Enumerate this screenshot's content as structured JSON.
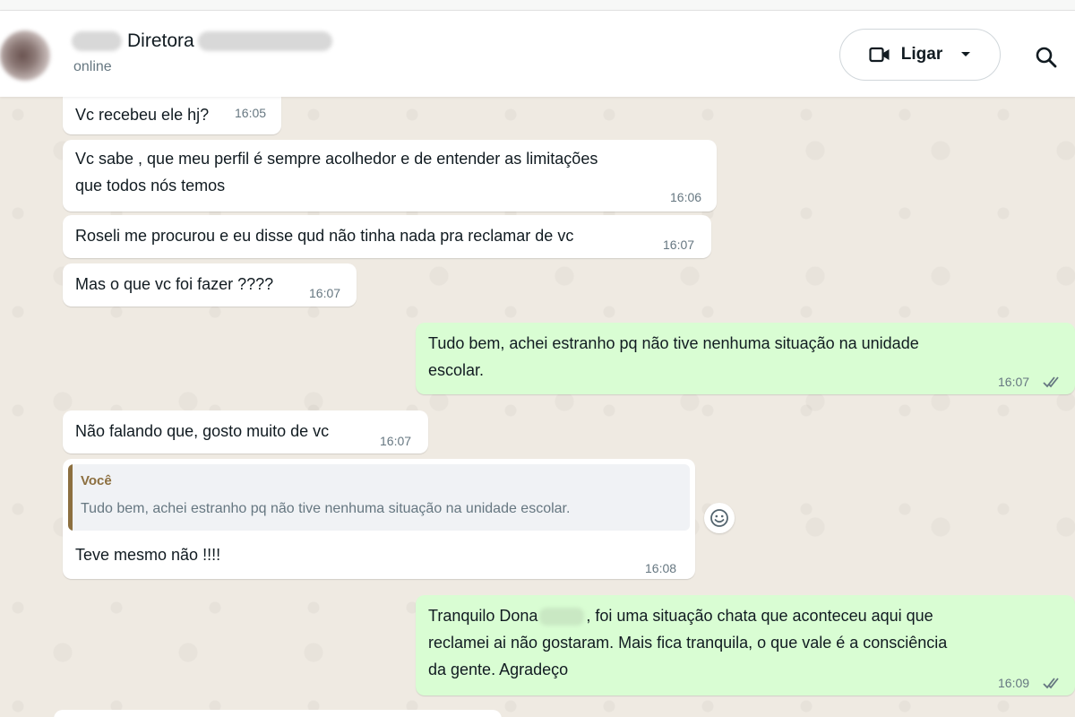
{
  "header": {
    "contact_name": "Diretora",
    "status": "online",
    "call_label": "Ligar"
  },
  "messages": [
    {
      "dir": "in",
      "text": "Vc recebeu ele hj?",
      "time": "16:05"
    },
    {
      "dir": "in",
      "text_lines": [
        "Vc sabe , que meu perfil é sempre acolhedor e de entender as limitações",
        "que todos nós temos"
      ],
      "time": "16:06"
    },
    {
      "dir": "in",
      "text": "Roseli me procurou e eu disse qud não tinha nada pra reclamar de vc",
      "time": "16:07"
    },
    {
      "dir": "in",
      "text": "Mas o que vc foi fazer ????",
      "time": "16:07"
    },
    {
      "dir": "out",
      "text_lines": [
        "Tudo bem, achei estranho pq não tive nenhuma situação na unidade",
        "escolar."
      ],
      "time": "16:07",
      "status": "read"
    },
    {
      "dir": "in",
      "text": "Não falando que, gosto muito de vc",
      "time": "16:07"
    },
    {
      "dir": "in",
      "quote": {
        "author": "Você",
        "text": "Tudo bem, achei estranho pq não tive nenhuma situação na unidade escolar."
      },
      "text": "Teve mesmo não !!!!",
      "time": "16:08"
    },
    {
      "dir": "out",
      "text_lines": [
        "Tranquilo Dona",
        ", foi uma situação chata que aconteceu aqui que",
        "reclamei ai não gostaram. Mais fica tranquila, o que vale é a consciência",
        "da gente. Agradeço"
      ],
      "time": "16:09",
      "status": "read"
    }
  ],
  "colors": {
    "chat_background": "#efeae2",
    "incoming_bubble": "#ffffff",
    "outgoing_bubble": "#d9fdd3",
    "read_ticks": "#667781",
    "quote_accent": "#8c6f3f"
  },
  "icons": {
    "avatar": "avatar",
    "call": "video-camera-icon",
    "dropdown": "caret-down-icon",
    "search": "search-icon",
    "react": "emoji-smile-icon",
    "ticks": "double-check-icon"
  }
}
